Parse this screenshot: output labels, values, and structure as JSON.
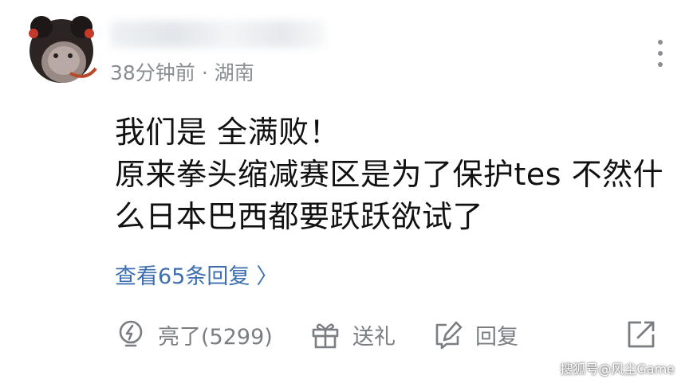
{
  "comment": {
    "time": "38分钟前",
    "separator": "·",
    "location": "湖南",
    "lines": [
      "我们是 全满败！",
      "原来拳头缩减赛区是为了保护tes 不然什",
      "么日本巴西都要跃跃欲试了"
    ],
    "replies_link": "查看65条回复",
    "replies_chevron": "〉"
  },
  "actions": {
    "like_label": "亮了(5299)",
    "gift_label": "送礼",
    "reply_label": "回复"
  },
  "watermark": "搜狐号@风尘Game"
}
